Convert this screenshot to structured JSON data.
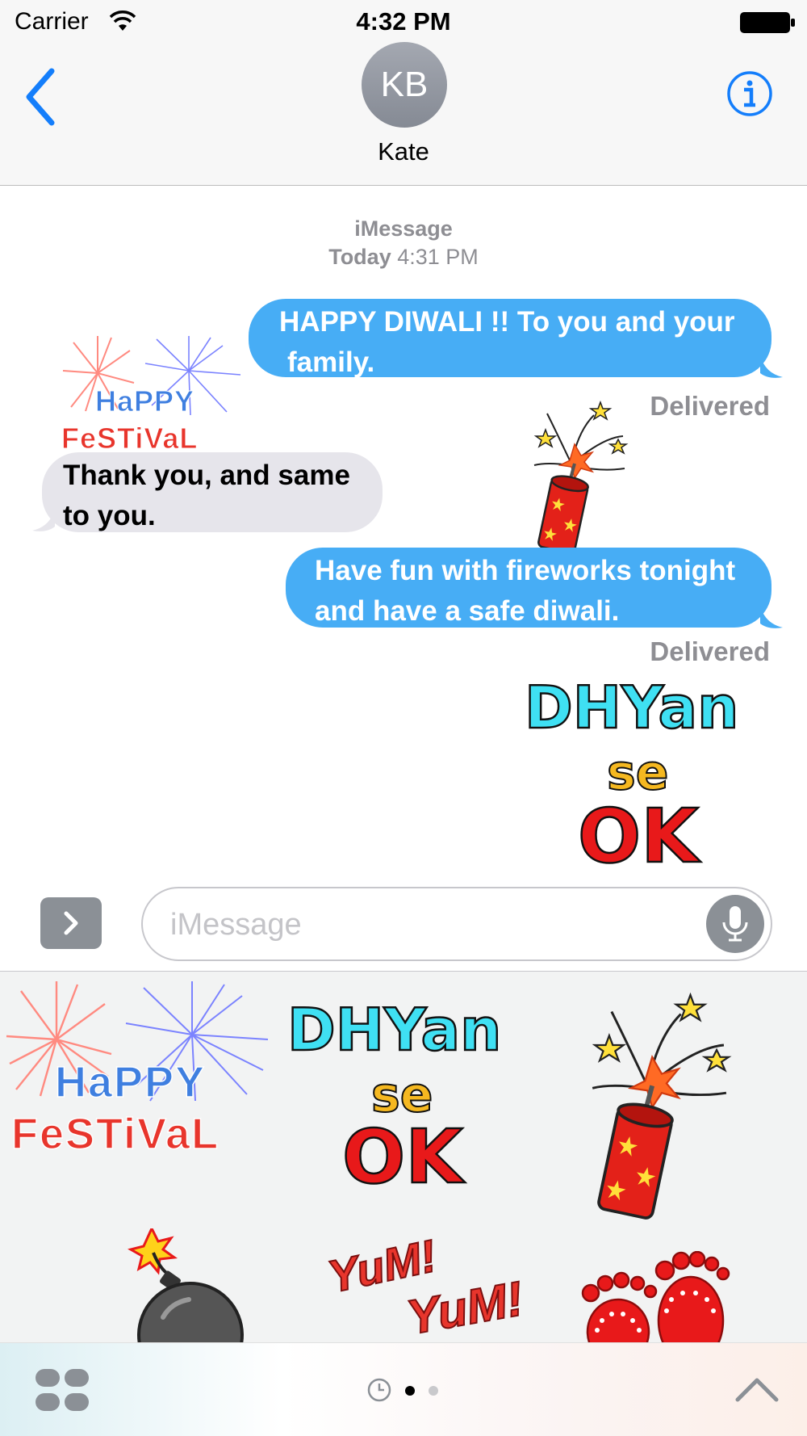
{
  "status_bar": {
    "carrier": "Carrier",
    "time": "4:32 PM"
  },
  "header": {
    "avatar_initials": "KB",
    "contact_name": "Kate"
  },
  "thread": {
    "service": "iMessage",
    "date_label": "Today",
    "time_label": "4:31 PM",
    "messages": [
      {
        "from": "me",
        "line1": "HAPPY DIWALI !! To you and your",
        "line2": "family."
      },
      {
        "from": "them",
        "line1": "Thank you, and same",
        "line2": "to you."
      },
      {
        "from": "me",
        "line1": "Have fun with fireworks tonight",
        "line2": "and have a safe diwali."
      }
    ],
    "delivered_label": "Delivered"
  },
  "stickers": {
    "happy_festival": {
      "word1": "HaPPY",
      "word2": "FeSTiVaL"
    },
    "dhyan_se_ok": {
      "word1": "DHYan",
      "word2": "se",
      "word3": "OK"
    },
    "yum_yum": {
      "word1": "YuM!",
      "word2": "YuM!"
    }
  },
  "composer": {
    "placeholder": "iMessage"
  },
  "colors": {
    "accent": "#147efb",
    "bubble_out": "#47adf5",
    "bubble_in": "#e6e5eb",
    "meta_gray": "#8e8e93"
  },
  "icons": [
    "wifi-icon",
    "battery-icon",
    "back-chevron-icon",
    "info-icon",
    "app-drawer-chevron-icon",
    "microphone-icon",
    "app-grid-icon",
    "recents-clock-icon",
    "expand-chevron-icon"
  ]
}
